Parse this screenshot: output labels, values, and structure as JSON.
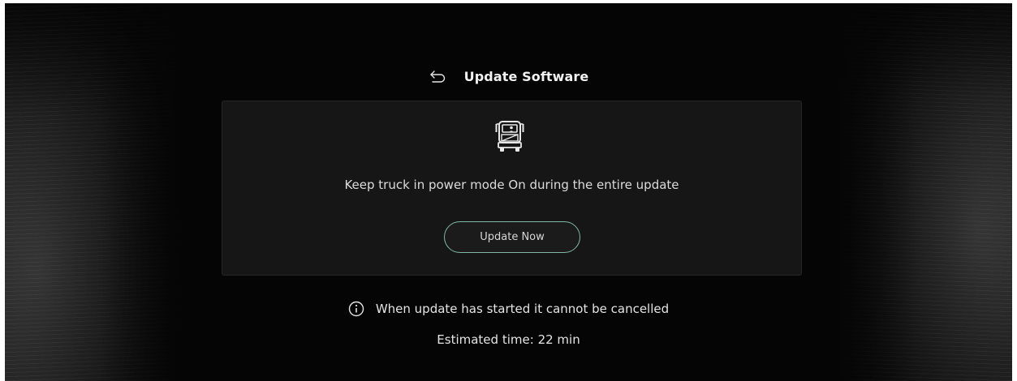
{
  "header": {
    "back_icon": "back-arrow-icon",
    "title": "Update Software"
  },
  "card": {
    "icon": "truck-icon",
    "message": "Keep truck in power mode On during the entire update",
    "button_label": "Update Now",
    "button_border_color": "#7fb8a6"
  },
  "warning": {
    "icon": "info-icon",
    "text": "When update has started it cannot be cancelled"
  },
  "estimate": {
    "label": "Estimated time:",
    "value": "22 min"
  },
  "colors": {
    "background": "#050505",
    "card": "#161616",
    "text": "#e4e4e4",
    "accent": "#7fb8a6"
  }
}
